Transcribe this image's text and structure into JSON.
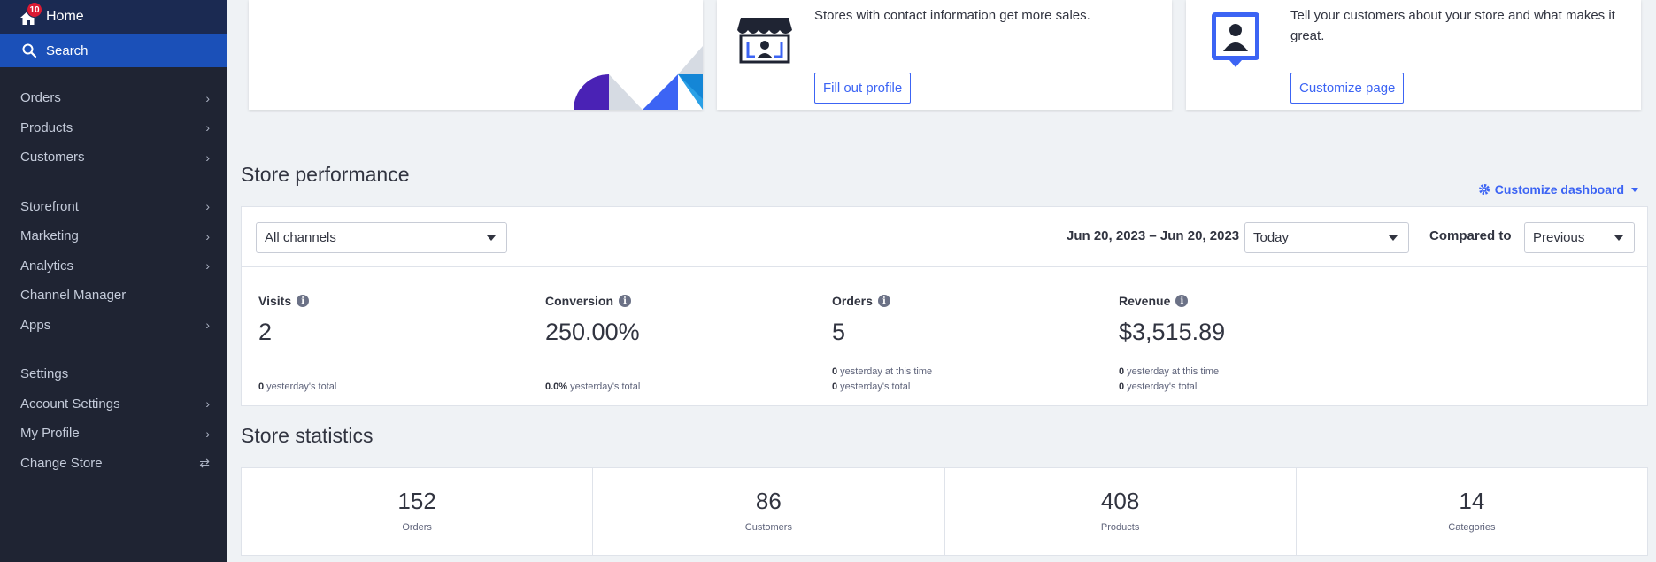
{
  "sidebar": {
    "home": {
      "label": "Home",
      "badge": "10"
    },
    "search": {
      "label": "Search"
    },
    "group1": [
      {
        "label": "Orders",
        "chevron": "›"
      },
      {
        "label": "Products",
        "chevron": "›"
      },
      {
        "label": "Customers",
        "chevron": "›"
      }
    ],
    "group2": [
      {
        "label": "Storefront",
        "chevron": "›"
      },
      {
        "label": "Marketing",
        "chevron": "›"
      },
      {
        "label": "Analytics",
        "chevron": "›"
      },
      {
        "label": "Channel Manager",
        "chevron": ""
      },
      {
        "label": "Apps",
        "chevron": "›"
      }
    ],
    "group3": [
      {
        "label": "Settings",
        "chevron": ""
      },
      {
        "label": "Account Settings",
        "chevron": "›"
      },
      {
        "label": "My Profile",
        "chevron": "›"
      },
      {
        "label": "Change Store",
        "chevron": "⇄"
      }
    ]
  },
  "cards": {
    "profile": {
      "text": "Stores with contact information get more sales.",
      "button": "Fill out profile",
      "icon": "storefront-icon"
    },
    "customize": {
      "text": "Tell your customers about your store and what makes it great.",
      "button": "Customize page",
      "icon": "person-badge-icon"
    }
  },
  "performance": {
    "title": "Store performance",
    "customize_link": "Customize dashboard",
    "channel_select": "All channels",
    "date_range": "Jun 20, 2023 – Jun 20, 2023",
    "period_select": "Today",
    "compared_label": "Compared to",
    "compared_select": "Previous",
    "metrics": [
      {
        "label": "Visits",
        "value": "2",
        "sub1_num": "",
        "sub1_text": "",
        "sub2_num": "0",
        "sub2_text": " yesterday's total"
      },
      {
        "label": "Conversion",
        "value": "250.00%",
        "sub1_num": "",
        "sub1_text": "",
        "sub2_num": "0.0%",
        "sub2_text": " yesterday's total"
      },
      {
        "label": "Orders",
        "value": "5",
        "sub1_num": "0",
        "sub1_text": " yesterday at this time",
        "sub2_num": "0",
        "sub2_text": " yesterday's total"
      },
      {
        "label": "Revenue",
        "value": "$3,515.89",
        "sub1_num": "0",
        "sub1_text": " yesterday at this time",
        "sub2_num": "0",
        "sub2_text": " yesterday's total"
      }
    ]
  },
  "statistics": {
    "title": "Store statistics",
    "items": [
      {
        "value": "152",
        "label": "Orders"
      },
      {
        "value": "86",
        "label": "Customers"
      },
      {
        "value": "408",
        "label": "Products"
      },
      {
        "value": "14",
        "label": "Categories"
      }
    ]
  },
  "colors": {
    "sidebar": "#1f2433",
    "search_bar": "#1b50b8",
    "accent": "#3c64f4",
    "badge": "#db1a33"
  }
}
